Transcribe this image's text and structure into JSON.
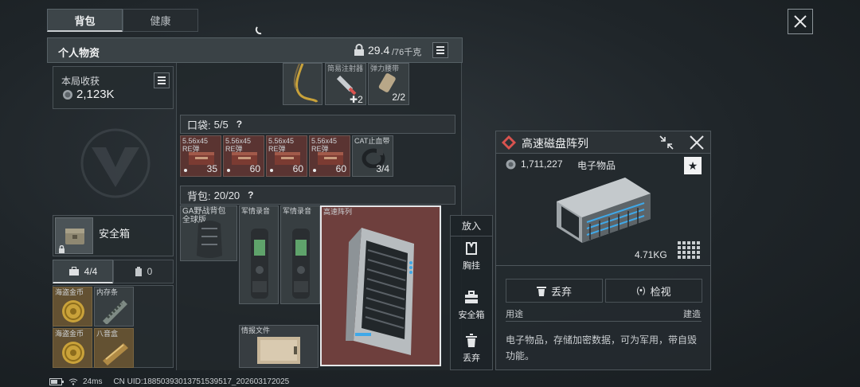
{
  "tabs": [
    {
      "label": "背包"
    },
    {
      "label": "健康"
    }
  ],
  "personal": {
    "title": "个人物资",
    "weight": "29.4",
    "weight_max": "/76千克"
  },
  "harvest": {
    "label": "本局收获",
    "value": "2,123K"
  },
  "safebox": {
    "label": "安全箱",
    "count": "4/4",
    "count2": "0"
  },
  "safebox_items": [
    {
      "name": "海盗金币"
    },
    {
      "name": "内存条"
    },
    {
      "name": "海盗金币"
    },
    {
      "name": "八音盒"
    }
  ],
  "top_items": [
    {
      "name": "简易注射器",
      "count": "2"
    },
    {
      "name": "弹力腰带",
      "count": "2/2"
    }
  ],
  "pocket": {
    "label": "口袋:",
    "count": "5/5",
    "help": "?",
    "items": [
      {
        "name": "5.56x45\nRE弹",
        "count": "35"
      },
      {
        "name": "5.56x45\nRE弹",
        "count": "60"
      },
      {
        "name": "5.56x45\nRE弹",
        "count": "60"
      },
      {
        "name": "5.56x45\nRE弹",
        "count": "60"
      },
      {
        "name": "CAT止血带",
        "count": "3/4"
      }
    ]
  },
  "backpack": {
    "label": "背包:",
    "count": "20/20",
    "help": "?",
    "items": [
      {
        "name": "GA野战背包\n全球版"
      },
      {
        "name": "军情录音"
      },
      {
        "name": "军情录音"
      },
      {
        "name": "高速阵列"
      },
      {
        "name": "情报文件"
      }
    ]
  },
  "put_in": {
    "label": "放入",
    "options": [
      {
        "label": "胸挂"
      },
      {
        "label": "安全箱"
      },
      {
        "label": "丢弃"
      }
    ]
  },
  "detail": {
    "title": "高速磁盘阵列",
    "price": "1,711,227",
    "category": "电子物品",
    "weight": "4.71KG",
    "discard": "丢弃",
    "inspect": "检视",
    "usage_label": "用途",
    "usage_value": "建造",
    "description": "电子物品，存储加密数据，可为军用，带自毁功能。"
  },
  "status": {
    "ping": "24ms",
    "uid": "CN UID:18850393013751539517_202603172025"
  },
  "colors": {
    "accent": "#e6e8ea",
    "highlight_slot": "#7a4a48",
    "diamond": "#d9534f"
  }
}
